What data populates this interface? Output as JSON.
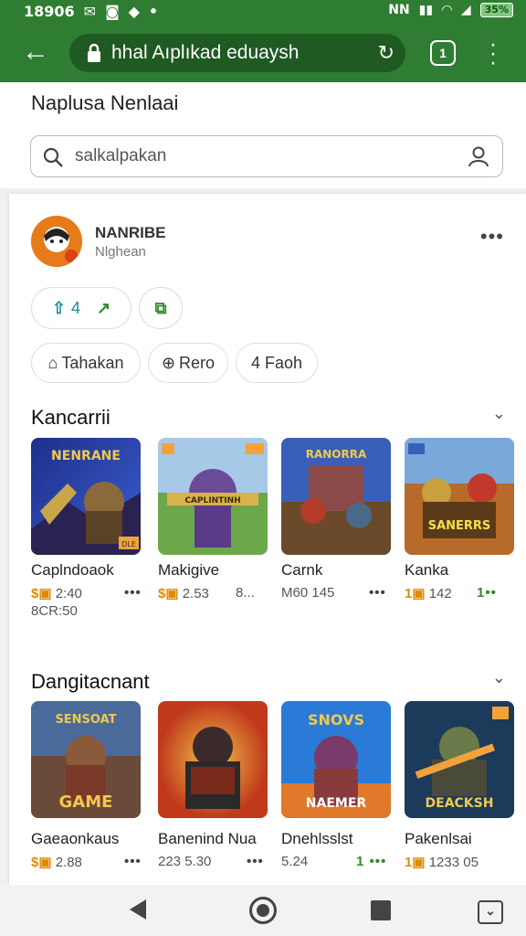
{
  "status": {
    "time": "18906",
    "right_text": "NN",
    "battery": "35%"
  },
  "toolbar": {
    "url": "hhal Aıplıkad eduaysh"
  },
  "page": {
    "title": "Naplusa Nenlaai"
  },
  "search": {
    "placeholder": "salkalpakan"
  },
  "profile": {
    "name": "NANRIBE",
    "sub": "Nlghean"
  },
  "actions": {
    "count": "4"
  },
  "chips": [
    {
      "label": "Tahakan"
    },
    {
      "label": "Rero"
    },
    {
      "label": "4  Faoh"
    }
  ],
  "section1": {
    "title": "Kancarrii",
    "items": [
      {
        "name": "Caplndoaok",
        "meta": "2:40",
        "extra": "8CR:50",
        "art_title": "NENRANE",
        "badge": "DLE"
      },
      {
        "name": "Makigive",
        "meta": "2.53",
        "dots": "8...",
        "art_title": "CAPLINTINH"
      },
      {
        "name": "Carnk",
        "meta": "M60 145",
        "art_title": "RANORRA"
      },
      {
        "name": "Kanka",
        "meta": "142",
        "art_title": "SANERRS"
      }
    ]
  },
  "section2": {
    "title": "Dangitacnant",
    "items": [
      {
        "name": "Gaeaonkaus",
        "meta": "2.88",
        "art_title": "GAME",
        "art_top": "SENSOAT"
      },
      {
        "name": "Banenind Nua",
        "meta": "223 5.30",
        "art_title": ""
      },
      {
        "name": "Dnehlsslst",
        "meta": "5.24",
        "art_title": "NAEMER",
        "art_top": "SNOVS"
      },
      {
        "name": "Pakenlsai",
        "meta": "1233 05",
        "art_title": "DEACKSH"
      }
    ]
  },
  "colors": {
    "brand": "#2f7d32",
    "accent_orange": "#e08a00",
    "accent_green": "#2e8b2e"
  }
}
